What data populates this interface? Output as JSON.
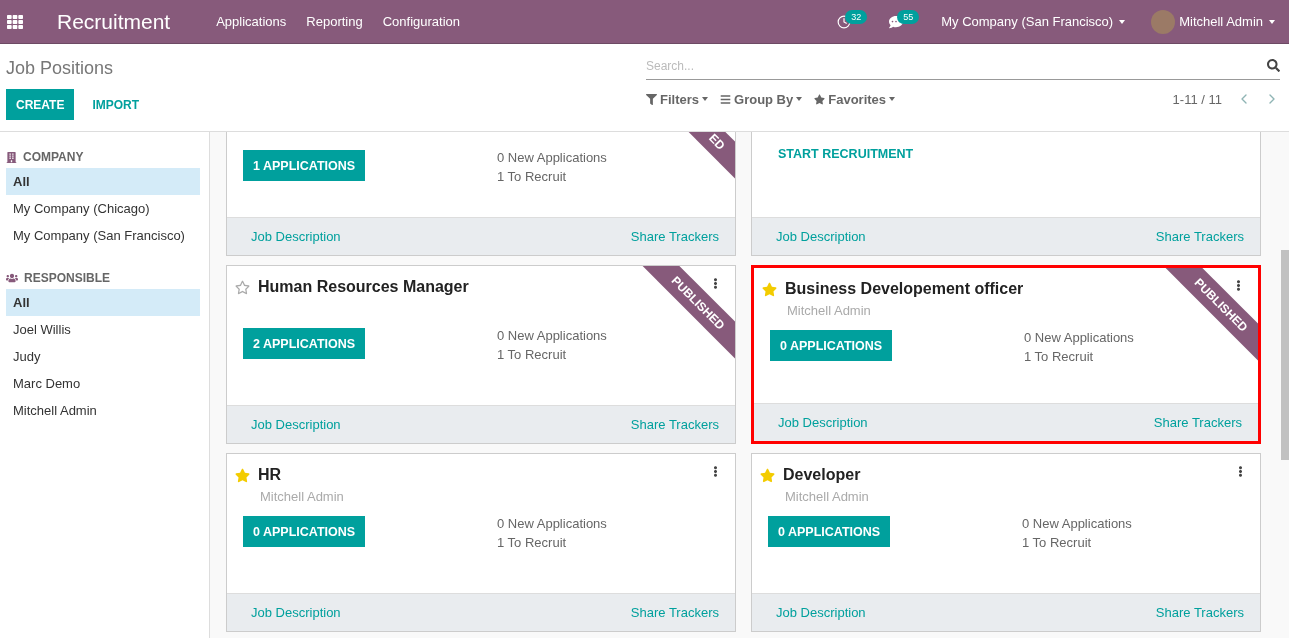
{
  "topbar": {
    "app_title": "Recruitment",
    "menu": [
      "Applications",
      "Reporting",
      "Configuration"
    ],
    "activity_count": "32",
    "message_count": "55",
    "company": "My Company (San Francisco)",
    "user": "Mitchell Admin"
  },
  "control_panel": {
    "title": "Job Positions",
    "create": "CREATE",
    "import": "IMPORT",
    "search": {
      "placeholder": "Search..."
    },
    "filters": [
      "Filters",
      "Group By",
      "Favorites"
    ],
    "pager": "1-11 / 11"
  },
  "sidebar": [
    {
      "kind": "company",
      "heading": "COMPANY",
      "items": [
        {
          "label": "All",
          "selected": true
        },
        {
          "label": "My Company (Chicago)",
          "selected": false
        },
        {
          "label": "My Company (San Francisco)",
          "selected": false
        }
      ]
    },
    {
      "kind": "people",
      "heading": "RESPONSIBLE",
      "items": [
        {
          "label": "All",
          "selected": true
        },
        {
          "label": "Joel Willis",
          "selected": false
        },
        {
          "label": "Judy",
          "selected": false
        },
        {
          "label": "Marc Demo",
          "selected": false
        },
        {
          "label": "Mitchell Admin",
          "selected": false
        }
      ]
    }
  ],
  "cards": [
    {
      "kind": "applications",
      "cut": true,
      "ribbon": "ED",
      "button": "1 APPLICATIONS",
      "new": "0 New Applications",
      "to_recruit": "1 To Recruit",
      "footer": [
        "Job Description",
        "Share Trackers"
      ],
      "highlighted": false
    },
    {
      "kind": "start",
      "cut": true,
      "button": "START RECRUITMENT",
      "footer": [
        "Job Description",
        "Share Trackers"
      ],
      "highlighted": false
    },
    {
      "kind": "applications",
      "cut": false,
      "title": "Human Resources Manager",
      "starred": false,
      "ribbon": "PUBLISHED",
      "button": "2 APPLICATIONS",
      "new": "0 New Applications",
      "to_recruit": "1 To Recruit",
      "footer": [
        "Job Description",
        "Share Trackers"
      ],
      "highlighted": false
    },
    {
      "kind": "applications",
      "cut": false,
      "title": "Business Developement officer",
      "starred": true,
      "responsible": "Mitchell Admin",
      "ribbon": "PUBLISHED",
      "button": "0 APPLICATIONS",
      "new": "0 New Applications",
      "to_recruit": "1 To Recruit",
      "footer": [
        "Job Description",
        "Share Trackers"
      ],
      "highlighted": true
    },
    {
      "kind": "applications",
      "cut": false,
      "title": "HR",
      "starred": true,
      "responsible": "Mitchell Admin",
      "button": "0 APPLICATIONS",
      "new": "0 New Applications",
      "to_recruit": "1 To Recruit",
      "footer": [
        "Job Description",
        "Share Trackers"
      ],
      "highlighted": false
    },
    {
      "kind": "applications",
      "cut": false,
      "title": "Developer",
      "starred": true,
      "responsible": "Mitchell Admin",
      "button": "0 APPLICATIONS",
      "new": "0 New Applications",
      "to_recruit": "1 To Recruit",
      "footer": [
        "Job Description",
        "Share Trackers"
      ],
      "highlighted": false
    }
  ]
}
